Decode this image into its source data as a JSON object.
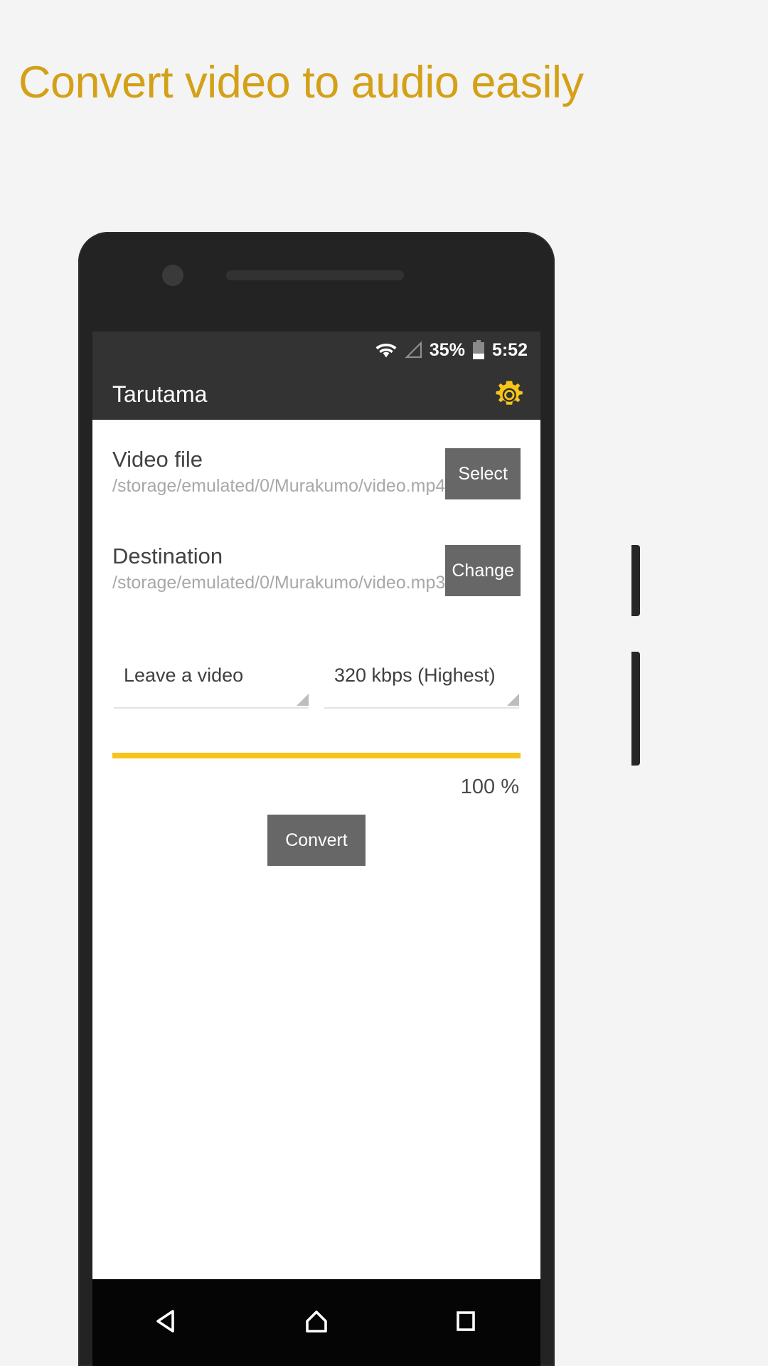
{
  "promo": {
    "headline": "Convert video to audio easily",
    "headline_color": "#d4a017",
    "background_color": "#f4f4f4"
  },
  "status_bar": {
    "wifi_icon": "wifi-icon",
    "signal_icon": "cell-signal-icon",
    "battery_percent": "35%",
    "battery_icon": "battery-icon",
    "time": "5:52",
    "background_color": "#333333"
  },
  "app_bar": {
    "title": "Tarutama",
    "settings_icon": "gear-icon",
    "settings_icon_color": "#f6c518",
    "background_color": "#333333"
  },
  "main": {
    "video_file": {
      "label": "Video file",
      "path": "/storage/emulated/0/Murakumo/video.mp4",
      "button_label": "Select"
    },
    "destination": {
      "label": "Destination",
      "path": "/storage/emulated/0/Murakumo/video.mp3",
      "button_label": "Change"
    },
    "options": {
      "video_mode": "Leave a video",
      "bitrate": "320 kbps (Highest)"
    },
    "progress": {
      "percent": 100,
      "percent_label": "100 %",
      "accent_color": "#f9c41a"
    },
    "convert_button_label": "Convert",
    "button_color": "#676767"
  },
  "nav_bar": {
    "back_icon": "back-triangle-icon",
    "home_icon": "home-icon",
    "recents_icon": "recents-square-icon",
    "background_color": "#050505"
  }
}
